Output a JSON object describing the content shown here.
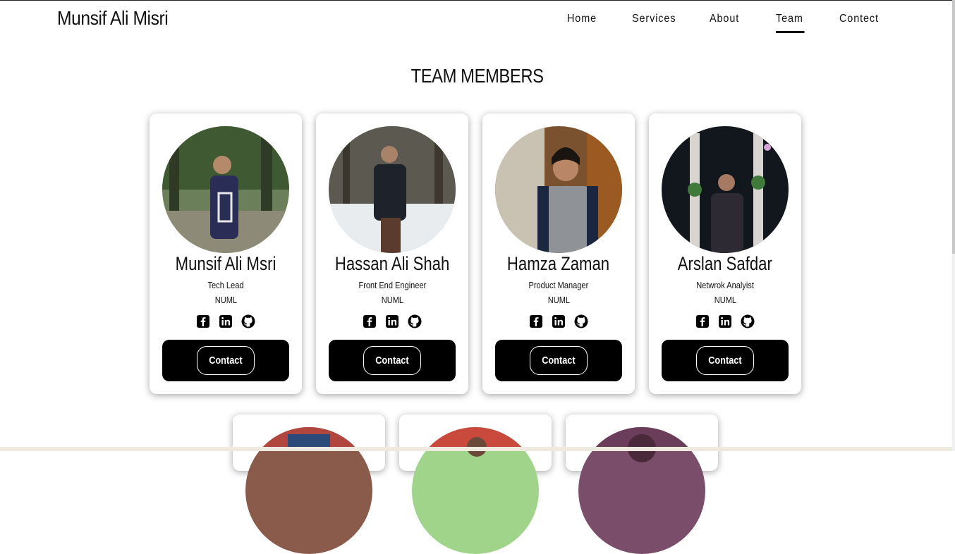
{
  "header": {
    "brand": "Munsif Ali Misri",
    "nav": [
      {
        "label": "Home"
      },
      {
        "label": "Services"
      },
      {
        "label": "About"
      },
      {
        "label": "Team",
        "active": true
      },
      {
        "label": "Contect"
      }
    ]
  },
  "section": {
    "title": "TEAM MEMBERS"
  },
  "members": [
    {
      "name": "Munsif Ali Msri",
      "role": "Tech Lead",
      "org": "NUML",
      "contact_label": "Contact"
    },
    {
      "name": "Hassan Ali Shah",
      "role": "Front End Engineer",
      "org": "NUML",
      "contact_label": "Contact"
    },
    {
      "name": "Hamza Zaman",
      "role": "Product Manager",
      "org": "NUML",
      "contact_label": "Contact"
    },
    {
      "name": "Arslan Safdar",
      "role": "Netwrok Analyist",
      "org": "NUML",
      "contact_label": "Contact"
    }
  ],
  "icons": [
    "facebook-icon",
    "linkedin-icon",
    "github-icon"
  ],
  "colors": {
    "accent": "#000000",
    "background": "#ffffff",
    "text": "#111111"
  }
}
